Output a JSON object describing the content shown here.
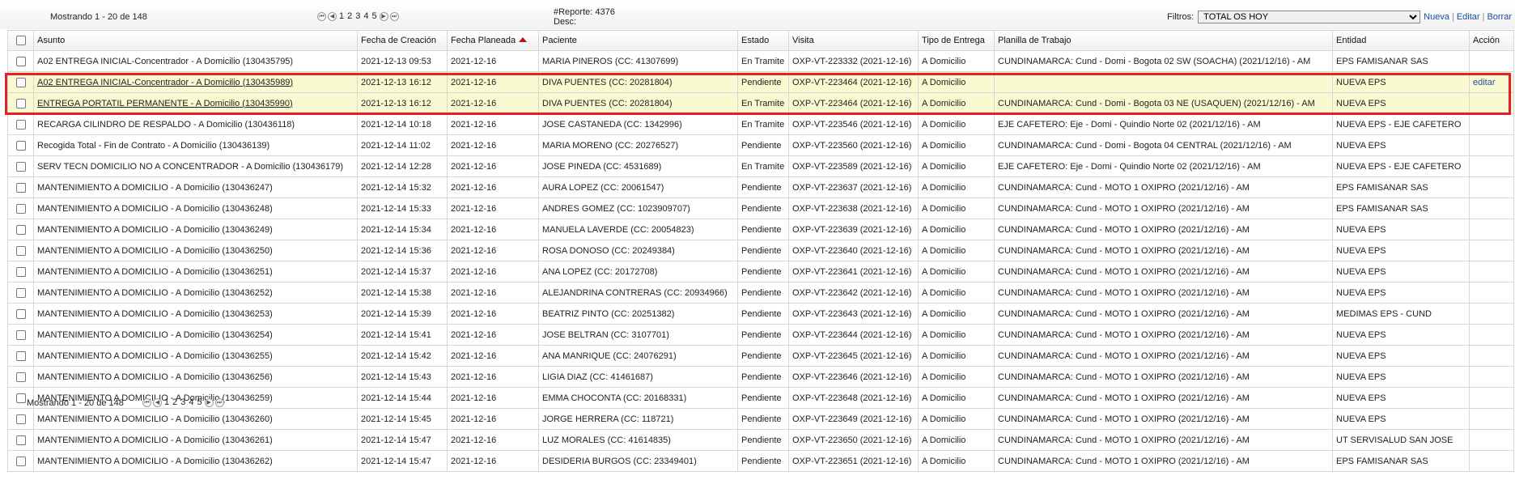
{
  "top": {
    "showing": "Mostrando 1 - 20 de 148",
    "pages": [
      "1",
      "2",
      "3",
      "4",
      "5"
    ],
    "reporte_label": "#Reporte: 4376",
    "desc_label": "Desc:",
    "filtros_label": "Filtros:",
    "filtro_selected": "TOTAL OS HOY",
    "nueva": "Nueva",
    "editar": "Editar",
    "borrar": "Borrar",
    "sep": "|"
  },
  "bottom": {
    "showing": "Mostrando 1 - 20 de 148",
    "pages": [
      "1",
      "2",
      "3",
      "4",
      "5"
    ]
  },
  "columns": [
    "Asunto",
    "Fecha de Creación",
    "Fecha Planeada",
    "Paciente",
    "Estado",
    "Visita",
    "Tipo de Entrega",
    "Planilla de Trabajo",
    "Entidad",
    "Acción"
  ],
  "rows": [
    [
      "A02 ENTREGA INICIAL-Concentrador - A Domicilio (130435795)",
      "2021-12-13 09:53",
      "2021-12-16",
      "MARIA PINEROS (CC: 41307699)",
      "En Tramite",
      "OXP-VT-223332 (2021-12-16)",
      "A Domicilio",
      "CUNDINAMARCA: Cund - Domi - Bogota 02 SW (SOACHA) (2021/12/16) - AM",
      "EPS FAMISANAR SAS",
      ""
    ],
    [
      "A02 ENTREGA INICIAL-Concentrador - A Domicilio (130435989)",
      "2021-12-13 16:12",
      "2021-12-16",
      "DIVA PUENTES (CC: 20281804)",
      "Pendiente",
      "OXP-VT-223464 (2021-12-16)",
      "A Domicilio",
      "",
      "NUEVA EPS",
      "editar"
    ],
    [
      "ENTREGA PORTATIL PERMANENTE - A Domicilio (130435990)",
      "2021-12-13 16:12",
      "2021-12-16",
      "DIVA PUENTES (CC: 20281804)",
      "En Tramite",
      "OXP-VT-223464 (2021-12-16)",
      "A Domicilio",
      "CUNDINAMARCA: Cund - Domi - Bogota 03 NE (USAQUEN) (2021/12/16) - AM",
      "NUEVA EPS",
      ""
    ],
    [
      "RECARGA CILINDRO DE RESPALDO - A Domicilio (130436118)",
      "2021-12-14 10:18",
      "2021-12-16",
      "JOSE CASTANEDA (CC: 1342996)",
      "En Tramite",
      "OXP-VT-223546 (2021-12-16)",
      "A Domicilio",
      "EJE CAFETERO: Eje - Domi - Quindio Norte 02 (2021/12/16) - AM",
      "NUEVA EPS - EJE CAFETERO",
      ""
    ],
    [
      "Recogida Total - Fin de Contrato - A Domicilio (130436139)",
      "2021-12-14 11:02",
      "2021-12-16",
      "MARIA MORENO (CC: 20276527)",
      "Pendiente",
      "OXP-VT-223560 (2021-12-16)",
      "A Domicilio",
      "CUNDINAMARCA: Cund - Domi - Bogota 04 CENTRAL (2021/12/16) - AM",
      "NUEVA EPS",
      ""
    ],
    [
      "SERV TECN DOMICILIO NO A CONCENTRADOR - A Domicilio (130436179)",
      "2021-12-14 12:28",
      "2021-12-16",
      "JOSE PINEDA (CC: 4531689)",
      "En Tramite",
      "OXP-VT-223589 (2021-12-16)",
      "A Domicilio",
      "EJE CAFETERO: Eje - Domi - Quindio Norte 02 (2021/12/16) - AM",
      "NUEVA EPS - EJE CAFETERO",
      ""
    ],
    [
      "MANTENIMIENTO A DOMICILIO - A Domicilio (130436247)",
      "2021-12-14 15:32",
      "2021-12-16",
      "AURA LOPEZ (CC: 20061547)",
      "Pendiente",
      "OXP-VT-223637 (2021-12-16)",
      "A Domicilio",
      "CUNDINAMARCA: Cund - MOTO 1 OXIPRO (2021/12/16) - AM",
      "EPS FAMISANAR SAS",
      ""
    ],
    [
      "MANTENIMIENTO A DOMICILIO - A Domicilio (130436248)",
      "2021-12-14 15:33",
      "2021-12-16",
      "ANDRES GOMEZ (CC: 1023909707)",
      "Pendiente",
      "OXP-VT-223638 (2021-12-16)",
      "A Domicilio",
      "CUNDINAMARCA: Cund - MOTO 1 OXIPRO (2021/12/16) - AM",
      "EPS FAMISANAR SAS",
      ""
    ],
    [
      "MANTENIMIENTO A DOMICILIO - A Domicilio (130436249)",
      "2021-12-14 15:34",
      "2021-12-16",
      "MANUELA LAVERDE (CC: 20054823)",
      "Pendiente",
      "OXP-VT-223639 (2021-12-16)",
      "A Domicilio",
      "CUNDINAMARCA: Cund - MOTO 1 OXIPRO (2021/12/16) - AM",
      "NUEVA EPS",
      ""
    ],
    [
      "MANTENIMIENTO A DOMICILIO - A Domicilio (130436250)",
      "2021-12-14 15:36",
      "2021-12-16",
      "ROSA DONOSO (CC: 20249384)",
      "Pendiente",
      "OXP-VT-223640 (2021-12-16)",
      "A Domicilio",
      "CUNDINAMARCA: Cund - MOTO 1 OXIPRO (2021/12/16) - AM",
      "NUEVA EPS",
      ""
    ],
    [
      "MANTENIMIENTO A DOMICILIO - A Domicilio (130436251)",
      "2021-12-14 15:37",
      "2021-12-16",
      "ANA LOPEZ (CC: 20172708)",
      "Pendiente",
      "OXP-VT-223641 (2021-12-16)",
      "A Domicilio",
      "CUNDINAMARCA: Cund - MOTO 1 OXIPRO (2021/12/16) - AM",
      "NUEVA EPS",
      ""
    ],
    [
      "MANTENIMIENTO A DOMICILIO - A Domicilio (130436252)",
      "2021-12-14 15:38",
      "2021-12-16",
      "ALEJANDRINA CONTRERAS (CC: 20934966)",
      "Pendiente",
      "OXP-VT-223642 (2021-12-16)",
      "A Domicilio",
      "CUNDINAMARCA: Cund - MOTO 1 OXIPRO (2021/12/16) - AM",
      "NUEVA EPS",
      ""
    ],
    [
      "MANTENIMIENTO A DOMICILIO - A Domicilio (130436253)",
      "2021-12-14 15:39",
      "2021-12-16",
      "BEATRIZ PINTO (CC: 20251382)",
      "Pendiente",
      "OXP-VT-223643 (2021-12-16)",
      "A Domicilio",
      "CUNDINAMARCA: Cund - MOTO 1 OXIPRO (2021/12/16) - AM",
      "MEDIMAS EPS - CUND",
      ""
    ],
    [
      "MANTENIMIENTO A DOMICILIO - A Domicilio (130436254)",
      "2021-12-14 15:41",
      "2021-12-16",
      "JOSE BELTRAN (CC: 3107701)",
      "Pendiente",
      "OXP-VT-223644 (2021-12-16)",
      "A Domicilio",
      "CUNDINAMARCA: Cund - MOTO 1 OXIPRO (2021/12/16) - AM",
      "NUEVA EPS",
      ""
    ],
    [
      "MANTENIMIENTO A DOMICILIO - A Domicilio (130436255)",
      "2021-12-14 15:42",
      "2021-12-16",
      "ANA MANRIQUE (CC: 24076291)",
      "Pendiente",
      "OXP-VT-223645 (2021-12-16)",
      "A Domicilio",
      "CUNDINAMARCA: Cund - MOTO 1 OXIPRO (2021/12/16) - AM",
      "NUEVA EPS",
      ""
    ],
    [
      "MANTENIMIENTO A DOMICILIO - A Domicilio (130436256)",
      "2021-12-14 15:43",
      "2021-12-16",
      "LIGIA DIAZ (CC: 41461687)",
      "Pendiente",
      "OXP-VT-223646 (2021-12-16)",
      "A Domicilio",
      "CUNDINAMARCA: Cund - MOTO 1 OXIPRO (2021/12/16) - AM",
      "NUEVA EPS",
      ""
    ],
    [
      "MANTENIMIENTO A DOMICILIO - A Domicilio (130436259)",
      "2021-12-14 15:44",
      "2021-12-16",
      "EMMA CHOCONTA (CC: 20168331)",
      "Pendiente",
      "OXP-VT-223648 (2021-12-16)",
      "A Domicilio",
      "CUNDINAMARCA: Cund - MOTO 1 OXIPRO (2021/12/16) - AM",
      "NUEVA EPS",
      ""
    ],
    [
      "MANTENIMIENTO A DOMICILIO - A Domicilio (130436260)",
      "2021-12-14 15:45",
      "2021-12-16",
      "JORGE HERRERA (CC: 118721)",
      "Pendiente",
      "OXP-VT-223649 (2021-12-16)",
      "A Domicilio",
      "CUNDINAMARCA: Cund - MOTO 1 OXIPRO (2021/12/16) - AM",
      "NUEVA EPS",
      ""
    ],
    [
      "MANTENIMIENTO A DOMICILIO - A Domicilio (130436261)",
      "2021-12-14 15:47",
      "2021-12-16",
      "LUZ MORALES (CC: 41614835)",
      "Pendiente",
      "OXP-VT-223650 (2021-12-16)",
      "A Domicilio",
      "CUNDINAMARCA: Cund - MOTO 1 OXIPRO (2021/12/16) - AM",
      "UT SERVISALUD SAN JOSE",
      ""
    ],
    [
      "MANTENIMIENTO A DOMICILIO - A Domicilio (130436262)",
      "2021-12-14 15:47",
      "2021-12-16",
      "DESIDERIA BURGOS (CC: 23349401)",
      "Pendiente",
      "OXP-VT-223651 (2021-12-16)",
      "A Domicilio",
      "CUNDINAMARCA: Cund - MOTO 1 OXIPRO (2021/12/16) - AM",
      "EPS FAMISANAR SAS",
      ""
    ]
  ],
  "highlighted_rows": [
    1,
    2
  ],
  "colors": {
    "highlight": "#fafad2",
    "selection_box": "#e3202a",
    "link": "#1a4f9c",
    "sort_arrow": "#b01818"
  }
}
